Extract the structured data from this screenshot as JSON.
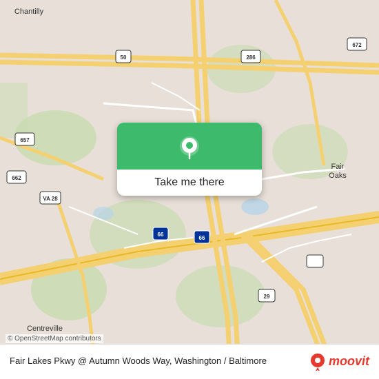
{
  "map": {
    "attribution": "© OpenStreetMap contributors",
    "bg_color": "#e8e0d8"
  },
  "button": {
    "label": "Take me there"
  },
  "location": {
    "name": "Fair Lakes Pkwy @ Autumn Woods Way, Washington / Baltimore"
  },
  "logo": {
    "text": "moovit"
  }
}
